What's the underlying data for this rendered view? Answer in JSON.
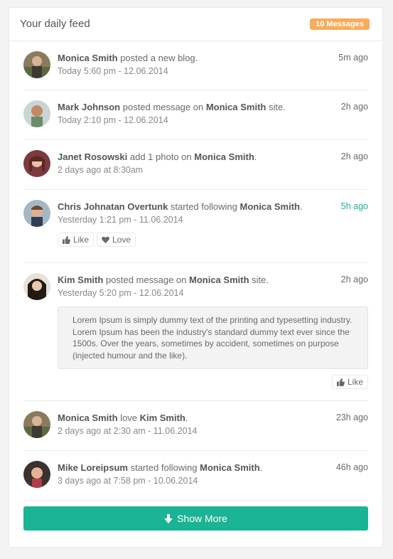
{
  "panel": {
    "title": "Your daily feed",
    "badge": "10 Messages"
  },
  "feed": [
    {
      "actor": "Monica Smith",
      "action": " posted a new blog.",
      "target": "",
      "tail": "",
      "time": "Today 5:60 pm - 12.06.2014",
      "ago": "5m ago"
    },
    {
      "actor": "Mark Johnson",
      "action": " posted message on ",
      "target": "Monica Smith",
      "tail": " site.",
      "time": "Today 2:10 pm - 12.06.2014",
      "ago": "2h ago"
    },
    {
      "actor": "Janet Rosowski",
      "action": " add 1 photo on ",
      "target": "Monica Smith",
      "tail": ".",
      "time": "2 days ago at 8:30am",
      "ago": "2h ago"
    },
    {
      "actor": "Chris Johnatan Overtunk",
      "action": " started following ",
      "target": "Monica Smith",
      "tail": ".",
      "time": "Yesterday 1:21 pm - 11.06.2014",
      "ago": "5h ago",
      "ago_color": "#1ab394",
      "buttons": [
        "Like",
        "Love"
      ]
    },
    {
      "actor": "Kim Smith",
      "action": " posted message on ",
      "target": "Monica Smith",
      "tail": " site.",
      "time": "Yesterday 5:20 pm - 12.06.2014",
      "ago": "2h ago",
      "quote": "Lorem Ipsum is simply dummy text of the printing and typesetting industry. Lorem Ipsum has been the industry's standard dummy text ever since the 1500s. Over the years, sometimes by accident, sometimes on purpose (injected humour and the like).",
      "like": "Like"
    },
    {
      "actor": "Monica Smith",
      "action": " love ",
      "target": "Kim Smith",
      "tail": ".",
      "time": "2 days ago at 2:30 am - 11.06.2014",
      "ago": "23h ago"
    },
    {
      "actor": "Mike Loreipsum",
      "action": " started following ",
      "target": "Monica Smith",
      "tail": ".",
      "time": "3 days ago at 7:58 pm - 10.06.2014",
      "ago": "46h ago"
    }
  ],
  "show_more": "Show More",
  "colors": {
    "accent": "#1ab394",
    "badge": "#f8ac59"
  }
}
